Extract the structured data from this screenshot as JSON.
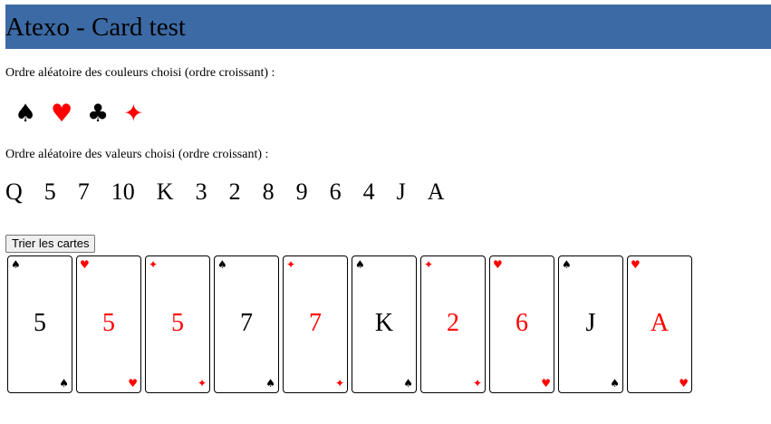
{
  "header": {
    "title": "Atexo - Card test",
    "background": "#3c6aa5"
  },
  "colors_section": {
    "label": "Ordre aléatoire des couleurs choisi (ordre croissant) :",
    "suits": [
      {
        "glyph": "♠",
        "icon": "spade-icon",
        "color": "#000000"
      },
      {
        "glyph": "♥",
        "icon": "heart-icon",
        "color": "#ff0000"
      },
      {
        "glyph": "♣",
        "icon": "club-icon",
        "color": "#000000"
      },
      {
        "glyph": "✦",
        "icon": "diamond-icon",
        "color": "#ff0000"
      }
    ]
  },
  "values_section": {
    "label": "Ordre aléatoire des valeurs choisi (ordre croissant) :",
    "values": [
      "Q",
      "5",
      "7",
      "10",
      "K",
      "3",
      "2",
      "8",
      "9",
      "6",
      "4",
      "J",
      "A"
    ]
  },
  "sort_button": {
    "label": "Trier les cartes"
  },
  "cards": [
    {
      "value": "5",
      "suit": "♠",
      "icon": "spade-icon",
      "color": "black"
    },
    {
      "value": "5",
      "suit": "♥",
      "icon": "heart-icon",
      "color": "red"
    },
    {
      "value": "5",
      "suit": "✦",
      "icon": "diamond-icon",
      "color": "red"
    },
    {
      "value": "7",
      "suit": "♠",
      "icon": "spade-icon",
      "color": "black"
    },
    {
      "value": "7",
      "suit": "✦",
      "icon": "diamond-icon",
      "color": "red"
    },
    {
      "value": "K",
      "suit": "♠",
      "icon": "spade-icon",
      "color": "black"
    },
    {
      "value": "2",
      "suit": "✦",
      "icon": "diamond-icon",
      "color": "red"
    },
    {
      "value": "6",
      "suit": "♥",
      "icon": "heart-icon",
      "color": "red"
    },
    {
      "value": "J",
      "suit": "♠",
      "icon": "spade-icon",
      "color": "black"
    },
    {
      "value": "A",
      "suit": "♥",
      "icon": "heart-icon",
      "color": "red"
    }
  ]
}
